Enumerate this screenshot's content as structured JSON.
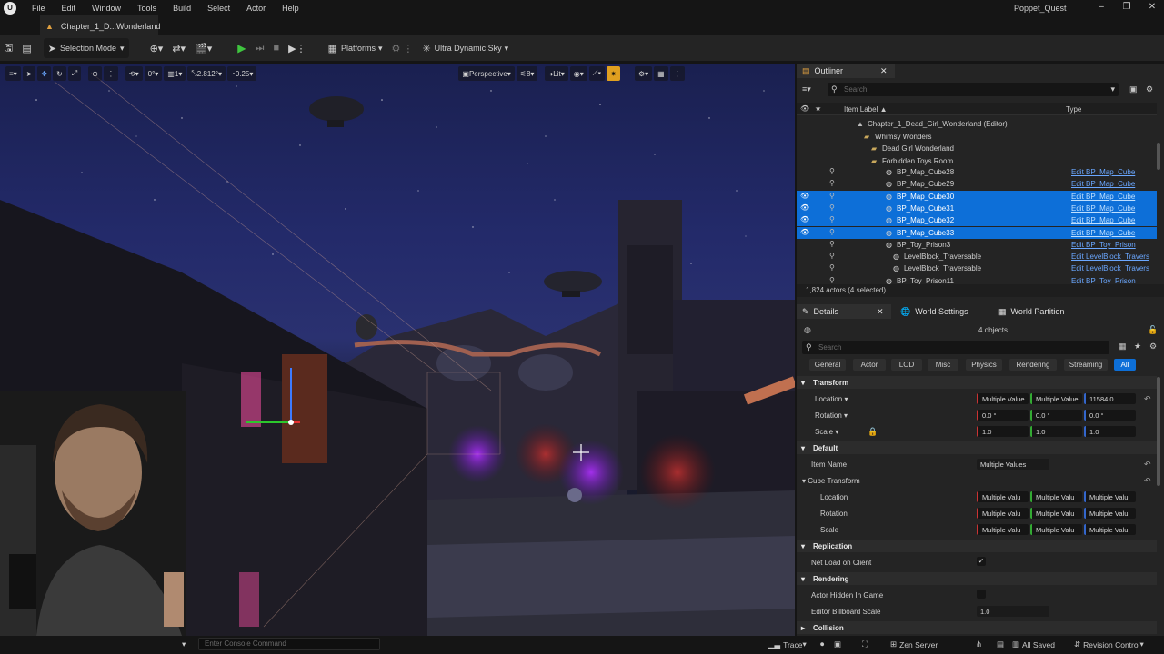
{
  "menu": [
    "File",
    "Edit",
    "Window",
    "Tools",
    "Build",
    "Select",
    "Actor",
    "Help"
  ],
  "project_name": "Poppet_Quest",
  "level_tab": "Chapter_1_D...Wonderland",
  "toolbar": {
    "selection_mode": "Selection Mode",
    "platforms": "Platforms",
    "sky": "Ultra Dynamic Sky"
  },
  "viewport": {
    "grid_snap": "0°",
    "rot_snap": "1",
    "scale_snap": "2.812°",
    "cam_speed": "0.25",
    "perspective": "Perspective",
    "fov": "8",
    "lit": "Lit",
    "translate_snap": "0"
  },
  "outliner": {
    "tab": "Outliner",
    "search_placeholder": "Search",
    "col_label": "Item Label",
    "col_type": "Type",
    "tree": [
      {
        "label": "Chapter_1_Dead_Girl_Wonderland (Editor)",
        "indent": 78,
        "icon": "level-icon",
        "type": ""
      },
      {
        "label": "Whimsy Wonders",
        "indent": 86,
        "icon": "folder-icon",
        "type": ""
      },
      {
        "label": "Dead Girl Wonderland",
        "indent": 94,
        "icon": "folder-icon",
        "type": ""
      },
      {
        "label": "Forbidden Toys Room",
        "indent": 94,
        "icon": "folder-icon",
        "type": ""
      }
    ],
    "rows": [
      {
        "label": "BP_Map_Cube28",
        "type": "Edit BP_Map_Cube",
        "sel": false,
        "indent": 110
      },
      {
        "label": "BP_Map_Cube29",
        "type": "Edit BP_Map_Cube",
        "sel": false,
        "indent": 110
      },
      {
        "label": "BP_Map_Cube30",
        "type": "Edit BP_Map_Cube",
        "sel": true,
        "indent": 110
      },
      {
        "label": "BP_Map_Cube31",
        "type": "Edit BP_Map_Cube",
        "sel": true,
        "indent": 110
      },
      {
        "label": "BP_Map_Cube32",
        "type": "Edit BP_Map_Cube",
        "sel": true,
        "indent": 110
      },
      {
        "label": "BP_Map_Cube33",
        "type": "Edit BP_Map_Cube",
        "sel": true,
        "indent": 110
      },
      {
        "label": "BP_Toy_Prison3",
        "type": "Edit BP_Toy_Prison",
        "sel": false,
        "indent": 110
      },
      {
        "label": "LevelBlock_Traversable",
        "type": "Edit LevelBlock_Travers",
        "sel": false,
        "indent": 118
      },
      {
        "label": "LevelBlock_Traversable",
        "type": "Edit LevelBlock_Travers",
        "sel": false,
        "indent": 118
      },
      {
        "label": "BP_Toy_Prison11",
        "type": "Edit BP_Toy_Prison",
        "sel": false,
        "indent": 110
      }
    ],
    "status": "1,824 actors (4 selected)"
  },
  "details": {
    "tab": "Details",
    "tab2": "World Settings",
    "tab3": "World Partition",
    "objects": "4 objects",
    "search_placeholder": "Search",
    "filters": [
      "General",
      "Actor",
      "LOD",
      "Misc",
      "Physics",
      "Rendering",
      "Streaming",
      "All"
    ],
    "transform": "Transform",
    "location": "Location",
    "rotation": "Rotation",
    "scale": "Scale",
    "loc_values": [
      "Multiple Value",
      "Multiple Value",
      "11584.0"
    ],
    "rot_values": [
      "0.0 °",
      "0.0 °",
      "0.0 °"
    ],
    "scale_values": [
      "1.0",
      "1.0",
      "1.0"
    ],
    "default": "Default",
    "item_name": "Item Name",
    "item_name_value": "Multiple Values",
    "cube_transform": "Cube Transform",
    "ct_location": "Location",
    "ct_rotation": "Rotation",
    "ct_scale": "Scale",
    "multi": "Multiple Valu",
    "replication": "Replication",
    "net_load": "Net Load on Client",
    "rendering": "Rendering",
    "actor_hidden": "Actor Hidden In Game",
    "billboard": "Editor Billboard Scale",
    "billboard_value": "1.0",
    "collision": "Collision"
  },
  "status": {
    "console_placeholder": "Enter Console Command",
    "trace": "Trace",
    "zen": "Zen Server",
    "saved": "All Saved",
    "revision": "Revision Control"
  }
}
